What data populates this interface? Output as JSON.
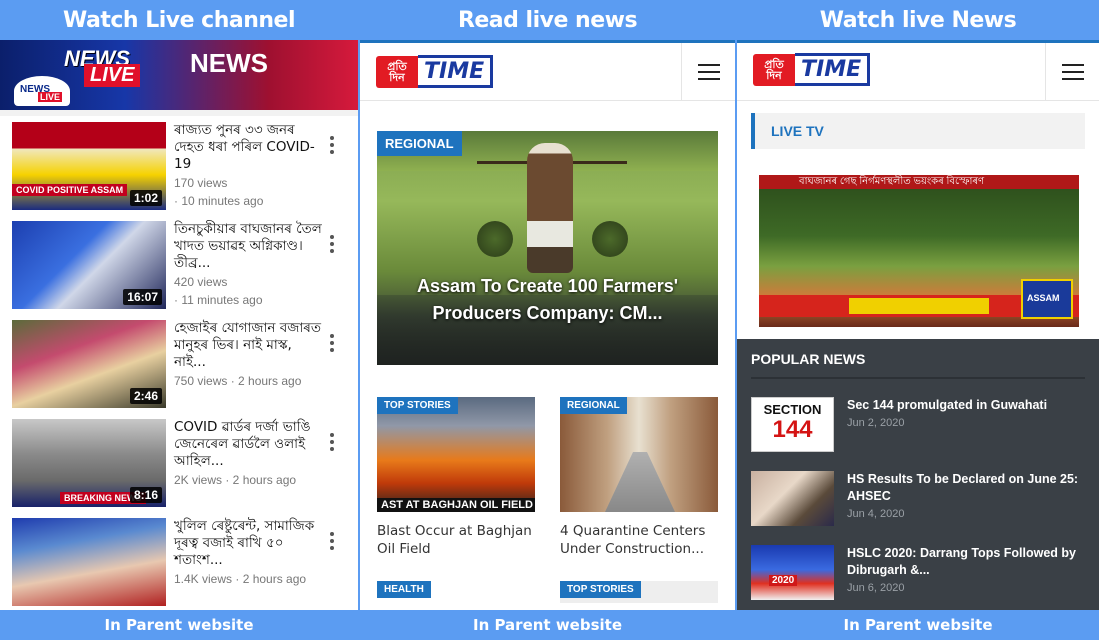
{
  "banners": {
    "left": "Watch  Live channel",
    "middle": "Read live news",
    "right": "Watch live News"
  },
  "footers": {
    "left": "In Parent website",
    "middle": "In Parent website",
    "right": "In Parent website"
  },
  "channel": {
    "banner_word1": "NEWS",
    "banner_word2": "LIVE",
    "banner_word3": "NEWS",
    "logo_word1": "NEWS",
    "logo_word2": "LIVE"
  },
  "videos": [
    {
      "title": "ৰাজ্যত পুনৰ ৩৩ জনৰ দেহত ধৰা পৰিল COVID-19",
      "views": "170 views",
      "age": "· 10 minutes ago",
      "duration": "1:02",
      "tag": "COVID POSITIVE ASSAM"
    },
    {
      "title": "তিনচুকীয়াৰ বাঘজানৰ তৈল খাদত ভয়াৱহ অগ্নিকাণ্ড। তীব্ৰ...",
      "views": "420 views",
      "age": "· 11 minutes ago",
      "duration": "16:07",
      "tag": ""
    },
    {
      "title": "হেজাইৰ যোগাজান বজাৰত মানুহৰ ভিৰ। নাই মাস্ক, নাই...",
      "views": "750 views · 2 hours ago",
      "age": "",
      "duration": "2:46",
      "tag": ""
    },
    {
      "title": "COVID ৱাৰ্ডৰ দৰ্জা ভাঙি জেনেৰেল ৱাৰ্ডলৈ ওলাই আহিল...",
      "views": "2K views · 2 hours ago",
      "age": "",
      "duration": "8:16",
      "tag": "BREAKING NEWS"
    },
    {
      "title": "খুলিল ৰেষ্টুৰেন্ট, সামাজিক দূৰত্ব বজাই ৰাখি ৫০ শতাংশ...",
      "views": "1.4K views · 2 hours ago",
      "age": "",
      "duration": "",
      "tag": ""
    }
  ],
  "site": {
    "logo_left": "প্ৰতি দিন",
    "logo_right": "TIME"
  },
  "featured": {
    "category": "REGIONAL",
    "title": "Assam To Create 100 Farmers' Producers Company: CM..."
  },
  "cards": [
    {
      "category": "TOP STORIES",
      "caption": "Blast Occur at Baghjan Oil Field",
      "overlay": "AST AT BAGHJAN OIL FIELD"
    },
    {
      "category": "REGIONAL",
      "caption": "4 Quarantine Centers Under Construction...",
      "overlay": ""
    }
  ],
  "more_cards": [
    {
      "category": "HEALTH"
    },
    {
      "category": "TOP STORIES"
    }
  ],
  "live": {
    "heading": "LIVE TV",
    "ticker": "বাঘজানৰ গেছ নিৰ্গমণস্থলীত ভয়ংকৰ বিস্ফোৰণ",
    "badge": "ASSAM"
  },
  "popular": {
    "heading": "POPULAR NEWS",
    "items": [
      {
        "title": "Sec 144 promulgated in Guwahati",
        "date": "Jun 2, 2020",
        "thumb_line1": "SECTION",
        "thumb_line2": "144"
      },
      {
        "title": "HS Results To be Declared on June 25: AHSEC",
        "date": "Jun 4, 2020"
      },
      {
        "title": "HSLC 2020: Darrang Tops Followed by Dibrugarh &...",
        "date": "Jun 6, 2020",
        "thumb_text": "2020"
      }
    ]
  },
  "colors": {
    "frame_blue": "#5b9cf2",
    "accent_blue": "#1e73be",
    "logo_red": "#e21b23",
    "popular_bg": "#3a4046"
  }
}
